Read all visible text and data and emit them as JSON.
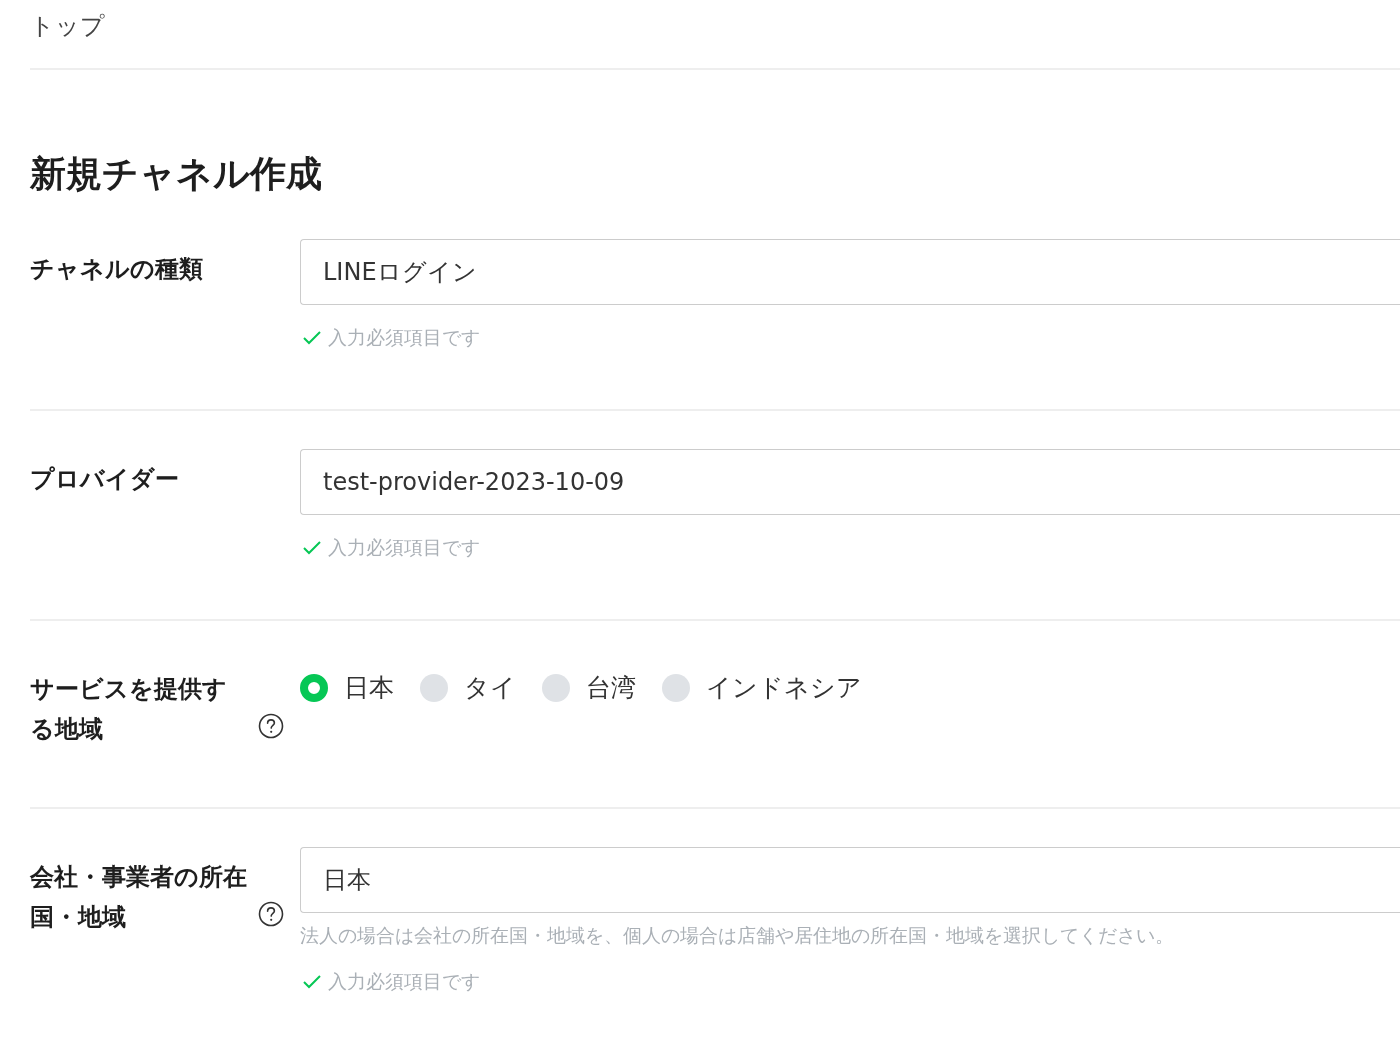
{
  "breadcrumb": "トップ",
  "title": "新規チャネル作成",
  "rows": [
    {
      "kind": "select",
      "label": "チャネルの種類",
      "help_icon": false,
      "value": "LINEログイン",
      "validation": "入力必須項目です"
    },
    {
      "kind": "select",
      "label": "プロバイダー",
      "help_icon": false,
      "value": "test-provider-2023-10-09",
      "validation": "入力必須項目です"
    },
    {
      "kind": "radio",
      "label": "サービスを提供する地域",
      "help_icon": true,
      "options": [
        {
          "label": "日本",
          "selected": true
        },
        {
          "label": "タイ",
          "selected": false
        },
        {
          "label": "台湾",
          "selected": false
        },
        {
          "label": "インドネシア",
          "selected": false
        }
      ]
    },
    {
      "kind": "select",
      "label": "会社・事業者の所在国・地域",
      "help_icon": true,
      "value": "日本",
      "hint": "法人の場合は会社の所在国・地域を、個人の場合は店舗や居住地の所在国・地域を選択してください。",
      "validation": "入力必須項目です"
    }
  ]
}
